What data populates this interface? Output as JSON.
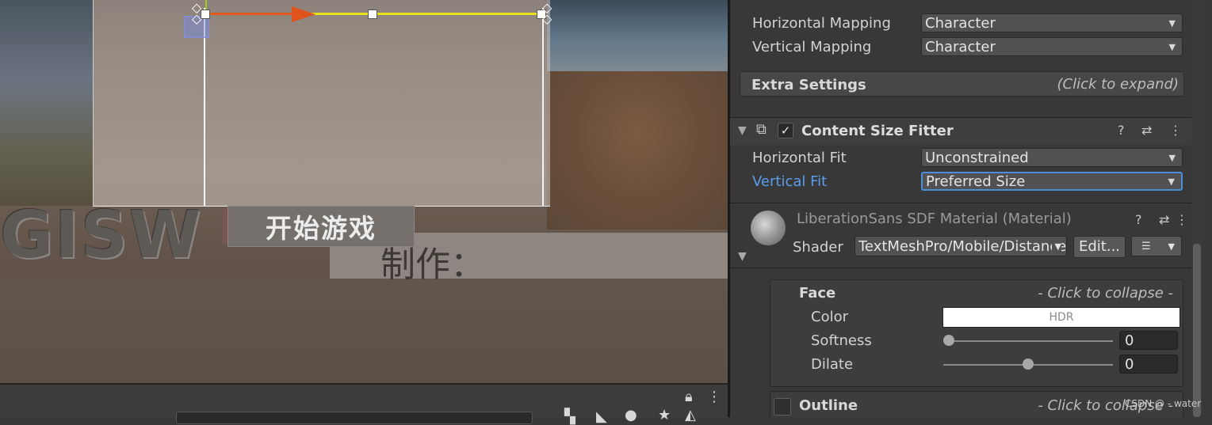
{
  "scene": {
    "background_text": "GISW",
    "credits_text": "制作：",
    "start_button_label": "开始游戏"
  },
  "inspector": {
    "horizontal_mapping": {
      "label": "Horizontal Mapping",
      "value": "Character"
    },
    "vertical_mapping": {
      "label": "Vertical Mapping",
      "value": "Character"
    },
    "extra_settings": {
      "title": "Extra Settings",
      "hint": "(Click to expand)"
    },
    "content_size_fitter": {
      "title": "Content Size Fitter",
      "enabled": true,
      "horizontal_fit": {
        "label": "Horizontal Fit",
        "value": "Unconstrained"
      },
      "vertical_fit": {
        "label": "Vertical Fit",
        "value": "Preferred Size"
      }
    },
    "material": {
      "title": "LiberationSans SDF Material (Material)",
      "shader_label": "Shader",
      "shader_value": "TextMeshPro/Mobile/Distance Field",
      "edit_label": "Edit...",
      "list_icon": "list-icon"
    },
    "face": {
      "title": "Face",
      "hint": "- Click to collapse -",
      "color_label": "Color",
      "color_value": "HDR",
      "color_hex": "#ffffff",
      "softness_label": "Softness",
      "softness_value": "0",
      "softness_fraction": 0.0,
      "dilate_label": "Dilate",
      "dilate_value": "0",
      "dilate_fraction": 0.5
    },
    "outline": {
      "title": "Outline",
      "hint": "- Click to collapse -",
      "enabled": false
    }
  },
  "watermark": "CSDN @ - water",
  "colors": {
    "inspector_bg": "#383838",
    "focus_blue": "#4a8fd8",
    "link_blue": "#5a9ded",
    "axis_yellow": "#e6e21a",
    "axis_red": "#e0531c"
  }
}
